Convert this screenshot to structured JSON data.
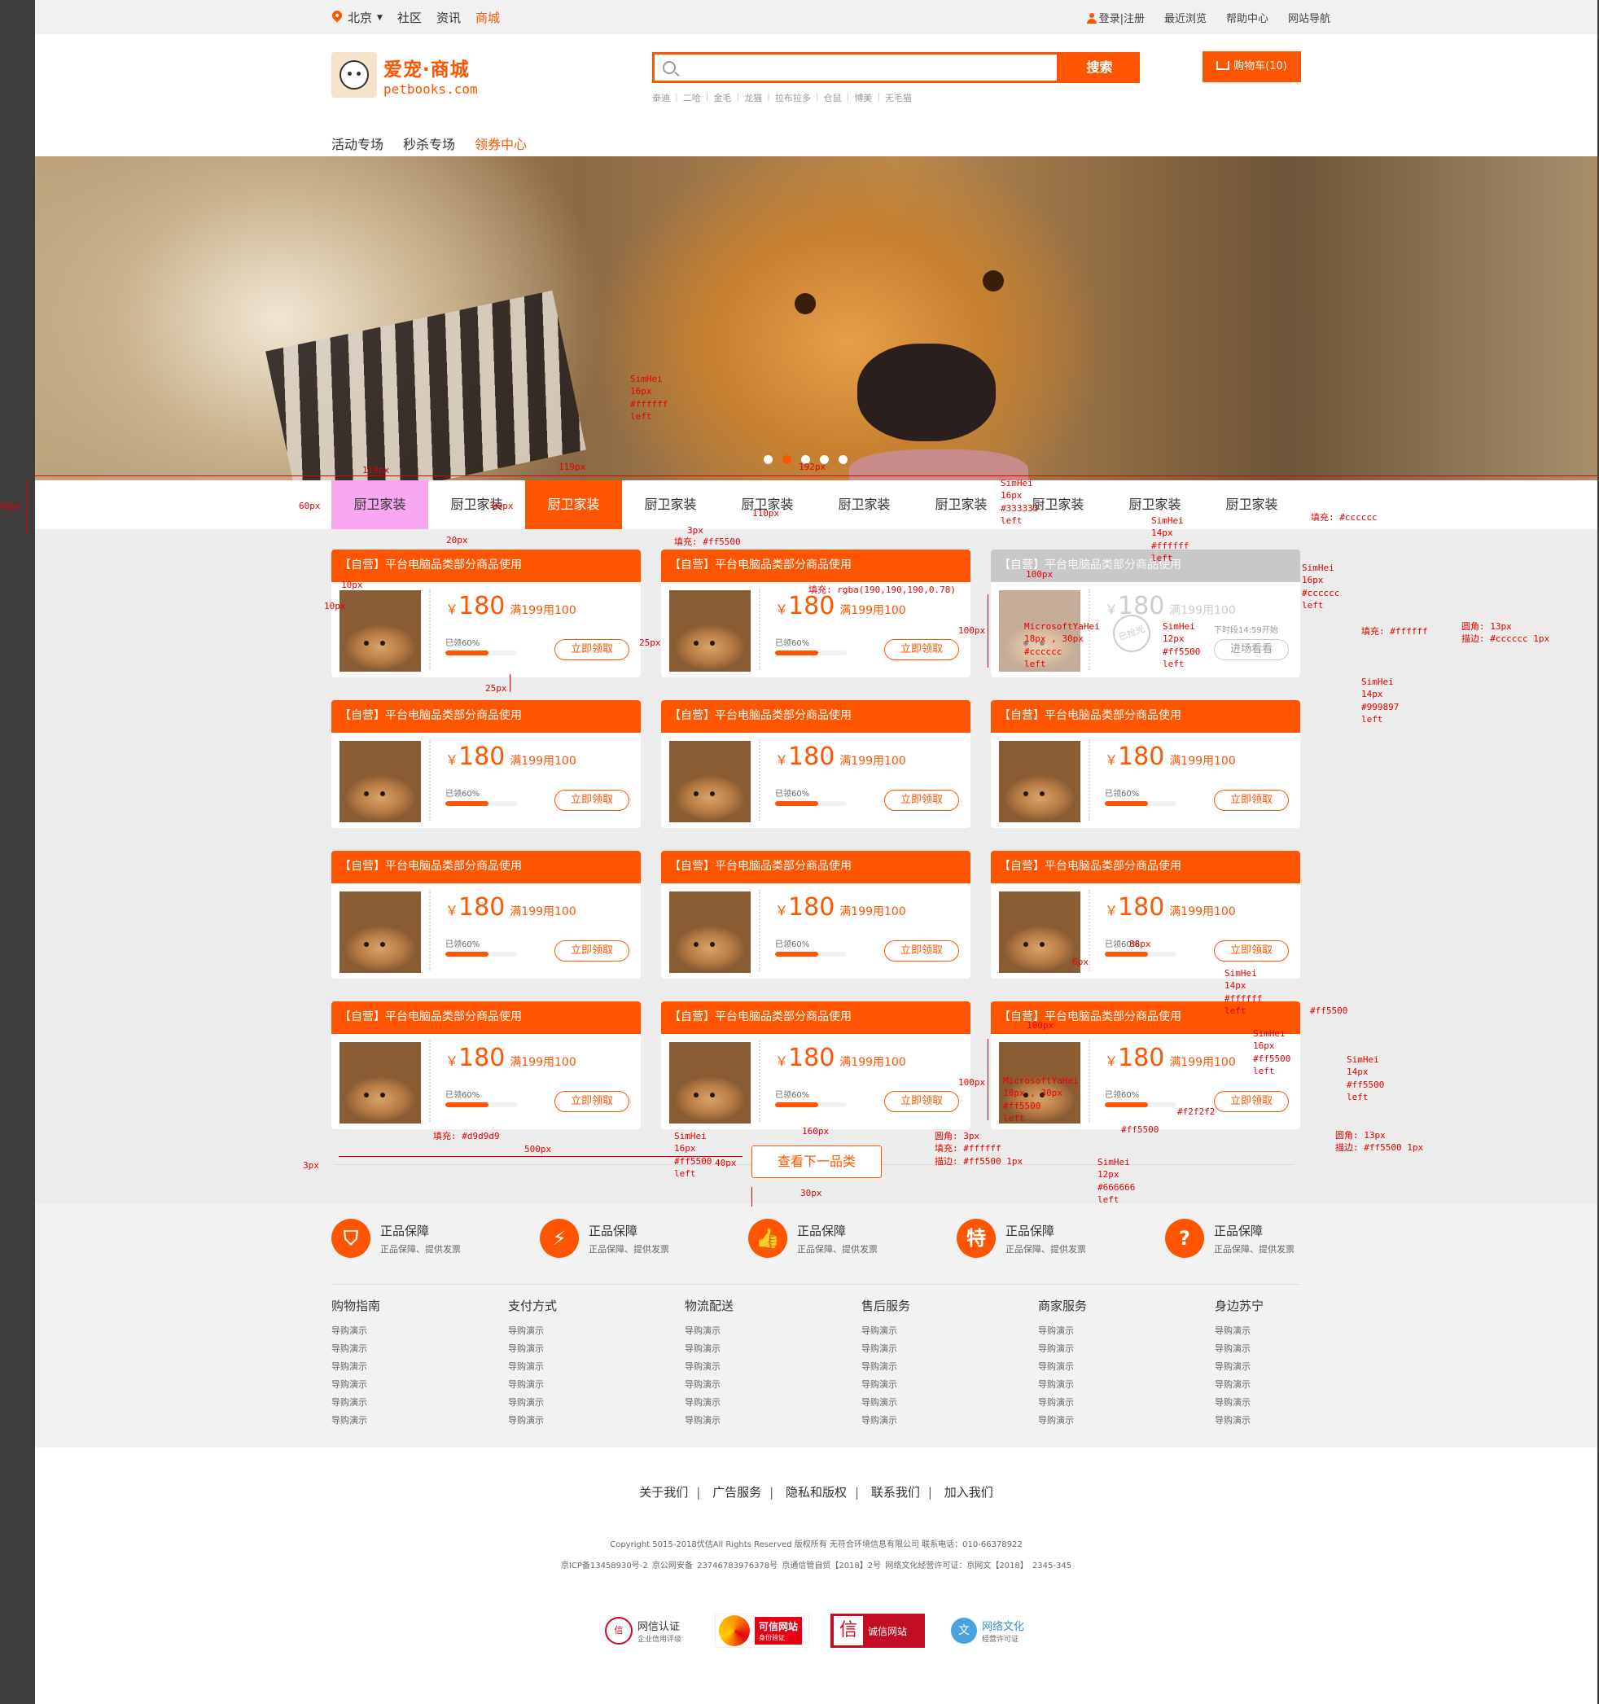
{
  "topbar": {
    "city": "北京",
    "links": [
      "社区",
      "资讯",
      "商城"
    ],
    "active_link": "商城",
    "right_links": [
      "登录|注册",
      "最近浏览",
      "帮助中心",
      "网站导航"
    ]
  },
  "logo": {
    "title": "爱宠·商城",
    "domain": "petbooks.com"
  },
  "search": {
    "placeholder": "",
    "button": "搜索"
  },
  "hot_words": [
    "泰迪",
    "二哈",
    "金毛",
    "龙猫",
    "拉布拉多",
    "仓鼠",
    "博美",
    "无毛猫"
  ],
  "cart": {
    "label": "购物车(10)"
  },
  "nav": {
    "items": [
      "活动专场",
      "秒杀专场",
      "领券中心"
    ],
    "active": "领券中心"
  },
  "banner": {
    "dot_count": 5,
    "active_dot": 1
  },
  "category_tabs": [
    "厨卫家装",
    "厨卫家装",
    "厨卫家装",
    "厨卫家装",
    "厨卫家装",
    "厨卫家装",
    "厨卫家装",
    "厨卫家装",
    "厨卫家装",
    "厨卫家装"
  ],
  "active_tab": 2,
  "coupon": {
    "title": "【自营】平台电脑品类部分商品使用",
    "currency": "￥",
    "amount": "180",
    "condition": "满199用100",
    "taken_label": "已领60%",
    "progress": 0.6,
    "button": "立即领取"
  },
  "gone_coupon": {
    "stamp": "已抢光",
    "start_text": "下时段14:59开始",
    "button": "进场看看"
  },
  "more_button": "查看下一品类",
  "guarantees": [
    {
      "icon": "shield-icon",
      "title": "正品保障",
      "sub": "正品保障、提供发票"
    },
    {
      "icon": "bolt-icon",
      "title": "正品保障",
      "sub": "正品保障、提供发票"
    },
    {
      "icon": "thumb-icon",
      "title": "正品保障",
      "sub": "正品保障、提供发票"
    },
    {
      "icon": "special-icon",
      "title": "正品保障",
      "sub": "正品保障、提供发票",
      "glyph": "特"
    },
    {
      "icon": "question-icon",
      "title": "正品保障",
      "sub": "正品保障、提供发票",
      "glyph": "?"
    }
  ],
  "footer_columns": [
    {
      "title": "购物指南",
      "items": [
        "导购演示",
        "导购演示",
        "导购演示",
        "导购演示",
        "导购演示",
        "导购演示"
      ]
    },
    {
      "title": "支付方式",
      "items": [
        "导购演示",
        "导购演示",
        "导购演示",
        "导购演示",
        "导购演示",
        "导购演示"
      ]
    },
    {
      "title": "物流配送",
      "items": [
        "导购演示",
        "导购演示",
        "导购演示",
        "导购演示",
        "导购演示",
        "导购演示"
      ]
    },
    {
      "title": "售后服务",
      "items": [
        "导购演示",
        "导购演示",
        "导购演示",
        "导购演示",
        "导购演示",
        "导购演示"
      ]
    },
    {
      "title": "商家服务",
      "items": [
        "导购演示",
        "导购演示",
        "导购演示",
        "导购演示",
        "导购演示",
        "导购演示"
      ]
    },
    {
      "title": "身边苏宁",
      "items": [
        "导购演示",
        "导购演示",
        "导购演示",
        "导购演示",
        "导购演示",
        "导购演示"
      ]
    }
  ],
  "footer_links": [
    "关于我们",
    "广告服务",
    "隐私和版权",
    "联系我们",
    "加入我们"
  ],
  "copyright": "Copyright  5015-2018优估All Rights Reserved 版权所有  无符合环境信息有限公司    联系电话：010-66378922",
  "licenses": "京ICP备13458930号-2        京公网安备 23746783976378号        京通信管自贸【2018】2号        网络文化经营许可证：京网文【2018】 2345-345",
  "badges": [
    {
      "name": "网信认证",
      "sub": "企业信用评级"
    },
    {
      "name": "可信网站",
      "sub": "身份验证"
    },
    {
      "name": "诚信网站",
      "sub": ""
    },
    {
      "name": "网络文化",
      "sub": "经营许可证"
    }
  ],
  "colors": {
    "accent": "#ff5500",
    "gray_bg": "#ececec",
    "pink_tab": "#f8a8f0",
    "muted": "#cccccc",
    "annotation": "#e60000"
  },
  "annotations": {
    "a1": "SimHei",
    "a2": "16px",
    "a3": "#ffffff",
    "a4": "left",
    "w119": "119px",
    "w119b": "119px",
    "w192": "192px",
    "h60": "60px",
    "h60b": "60px",
    "fill_ff5500": "填充: #ff5500",
    "px3": "3px",
    "px20": "20px",
    "px110": "110px",
    "px60": "60px",
    "b1": "SimHei",
    "b2": "16px",
    "b3": "#333333",
    "b4": "left",
    "c_fill": "填充: #cccccc",
    "d1": "SimHei",
    "d2": "14px",
    "d3": "#ffffff",
    "d4": "left",
    "e1": "SimHei",
    "e2": "16px",
    "e3": "#cccccc",
    "e4": "left",
    "rgba": "填充: rgba(190,190,190,0.78)",
    "f1": "MicrosoftYaHei",
    "f2": "18px , 30px",
    "f3": "#cccccc",
    "f4": "left",
    "g1": "SimHei",
    "g2": "12px",
    "g3": "#ff5500",
    "g4": "left",
    "fill_fff": "填充: #ffffff",
    "radius13": "圆角: 13px",
    "stroke_ccc": "描边: #cccccc  1px",
    "h1": "SimHei",
    "h2": "14px",
    "h3": "#999897",
    "h4": "left",
    "px10": "10px",
    "px10b": "10px",
    "px25": "25px",
    "px25b": "25px",
    "px100": "100px",
    "px100b": "100px",
    "px100c": "100px",
    "px100d": "100px",
    "px88": "88px",
    "px6": "6px",
    "i1": "SimHei",
    "i2": "14px",
    "i3": "#ffffff",
    "i4": "left",
    "i5": "#ff5500",
    "j1": "SimHei",
    "j2": "16px",
    "j3": "#ff5500",
    "j4": "left",
    "k1": "SimHei",
    "k2": "14px",
    "k3": "#ff5500",
    "k4": "left",
    "l1": "MicrosoftYaHei",
    "l2": "18px , 30px",
    "l3": "#ff5500",
    "l4": "left",
    "f2f2f2": "#f2f2f2",
    "ff5500b": "#ff5500",
    "radius13b": "圆角: 13px",
    "stroke_ff5500": "描边: #ff5500  1px",
    "m1": "SimHei",
    "m2": "12px",
    "m3": "#666666",
    "m4": "left",
    "fill_d9": "填充: #d9d9d9",
    "px500": "500px",
    "px3b": "3px",
    "n1": "SimHei",
    "n2": "16px",
    "n3": "#ff5500",
    "n4": "left",
    "px40": "40px",
    "px160": "160px",
    "px30": "30px",
    "o1": "圆角: 3px",
    "o2": "填充: #ffffff",
    "o3": "描边: #ff5500  1px"
  }
}
